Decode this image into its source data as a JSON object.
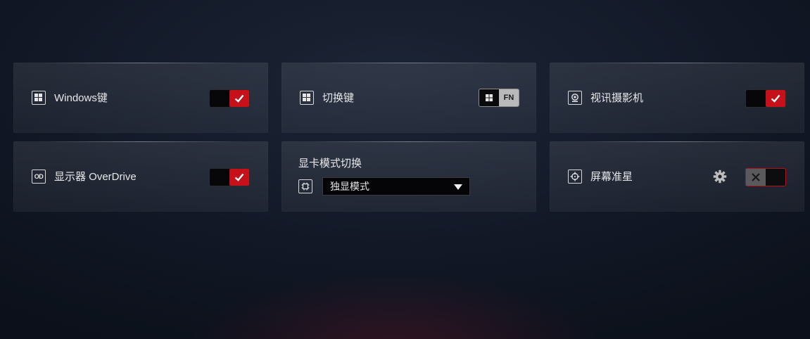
{
  "cards": {
    "windows_key": {
      "label": "Windows键",
      "icon": "windows-icon",
      "enabled": true
    },
    "switch_key": {
      "label": "切换键",
      "icon": "windows-icon",
      "toggle_left_icon": "windows-icon",
      "toggle_right_label": "FN",
      "selected": "FN"
    },
    "webcam": {
      "label": "视讯摄影机",
      "icon": "webcam-icon",
      "enabled": true
    },
    "overdrive": {
      "label": "显示器 OverDrive",
      "icon_text": "OD",
      "enabled": true
    },
    "gpu_mode": {
      "title": "显卡模式切换",
      "icon": "chip-icon",
      "selected_option": "独显模式"
    },
    "crosshair": {
      "label": "屏幕准星",
      "icon": "crosshair-icon",
      "settings_icon": "gear-icon",
      "enabled": false
    }
  },
  "colors": {
    "accent": "#c6111b",
    "card_bg": "#1f2532",
    "background": "#121826"
  }
}
